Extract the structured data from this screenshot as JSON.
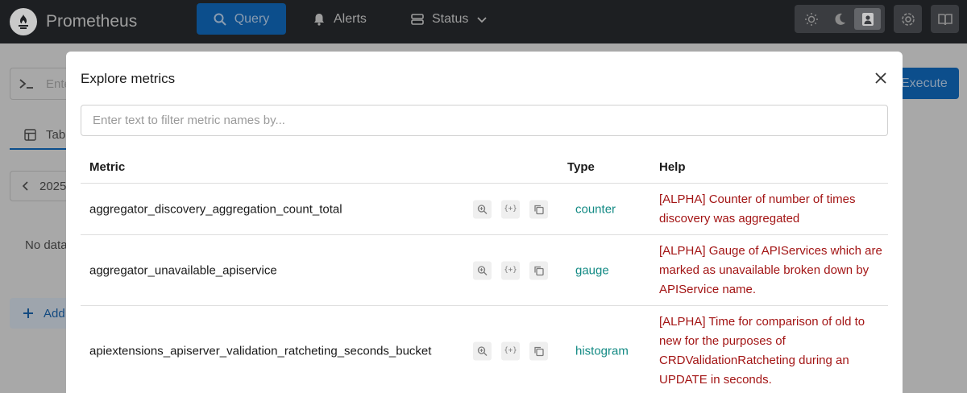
{
  "nav": {
    "brand": "Prometheus",
    "query": "Query",
    "alerts": "Alerts",
    "status": "Status"
  },
  "background": {
    "expression_placeholder": "Ente",
    "execute": "Execute",
    "tab": "Tab",
    "time": "2025",
    "no_data": "No data",
    "add_panel": "Add"
  },
  "modal": {
    "title": "Explore metrics",
    "filter_placeholder": "Enter text to filter metric names by...",
    "columns": {
      "metric": "Metric",
      "type": "Type",
      "help": "Help"
    },
    "rows": [
      {
        "name": "aggregator_discovery_aggregation_count_total",
        "type": "counter",
        "help": "[ALPHA] Counter of number of times discovery was aggregated"
      },
      {
        "name": "aggregator_unavailable_apiservice",
        "type": "gauge",
        "help": "[ALPHA] Gauge of APIServices which are marked as unavailable broken down by APIService name."
      },
      {
        "name": "apiextensions_apiserver_validation_ratcheting_seconds_bucket",
        "type": "histogram",
        "help": "[ALPHA] Time for comparison of old to new for the purposes of CRDValidationRatcheting during an UPDATE in seconds."
      }
    ],
    "actions": {
      "insert_label": "{+}"
    }
  },
  "colors": {
    "type_text": "#138a84",
    "help_text": "#a31515",
    "accent": "#0c4e8c"
  },
  "icons": [
    "prometheus-logo-icon",
    "search-icon",
    "bell-icon",
    "server-icon",
    "chevron-down-icon",
    "sun-icon",
    "moon-icon",
    "user-icon",
    "gear-icon",
    "book-icon",
    "close-icon",
    "magnify-plus-icon",
    "copy-icon"
  ]
}
